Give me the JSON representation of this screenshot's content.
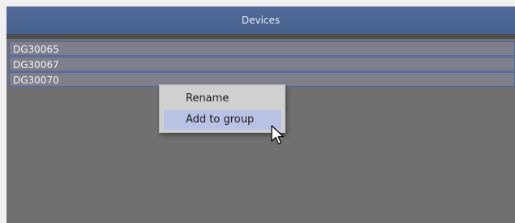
{
  "header": {
    "title": "Devices"
  },
  "devices": [
    {
      "label": "DG30065"
    },
    {
      "label": "DG30067"
    },
    {
      "label": "DG30070"
    }
  ],
  "context_menu": {
    "items": [
      {
        "label": "Rename",
        "highlighted": false
      },
      {
        "label": "Add to group",
        "highlighted": true
      }
    ]
  },
  "colors": {
    "header_bg": "#4c6592",
    "panel_bg": "#707070",
    "row_bg": "#7e7f8b",
    "row_border": "#4a68b8",
    "menu_bg": "#d0d0d0",
    "menu_highlight": "#b7c2e5"
  },
  "icons": {
    "cursor": "mouse-pointer-icon"
  }
}
